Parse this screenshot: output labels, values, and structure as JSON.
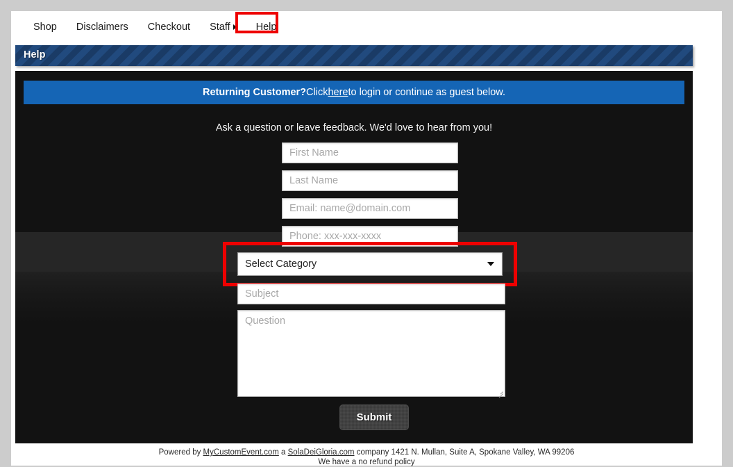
{
  "nav": {
    "items": [
      {
        "label": "Shop",
        "caret": false,
        "highlighted": false
      },
      {
        "label": "Disclaimers",
        "caret": false,
        "highlighted": false
      },
      {
        "label": "Checkout",
        "caret": false,
        "highlighted": false
      },
      {
        "label": "Staff",
        "caret": true,
        "highlighted": false
      },
      {
        "label": "Help",
        "caret": false,
        "highlighted": true
      }
    ]
  },
  "section": {
    "title": "Help"
  },
  "banner": {
    "bold_text": "Returning Customer?",
    "text_before_link": " Click ",
    "link_text": "here",
    "text_after_link": " to login or continue as guest below."
  },
  "intro": {
    "text": "Ask a question or leave feedback. We'd love to hear from you!"
  },
  "form": {
    "first_name": {
      "value": "",
      "placeholder": "First Name"
    },
    "last_name": {
      "value": "",
      "placeholder": "Last Name"
    },
    "email": {
      "value": "",
      "placeholder": "Email: name@domain.com"
    },
    "phone": {
      "value": "",
      "placeholder": "Phone: xxx-xxx-xxxx"
    },
    "category": {
      "selected": "Select Category"
    },
    "subject": {
      "value": "",
      "placeholder": "Subject"
    },
    "question": {
      "value": "",
      "placeholder": "Question"
    },
    "submit_label": "Submit"
  },
  "footer": {
    "prefix": "Powered by ",
    "link1": "MyCustomEvent.com",
    "middle": " a ",
    "link2": "SolaDeiGloria.com",
    "suffix": " company 1421 N. Mullan, Suite A, Spokane Valley, WA 99206",
    "line2": "We have a no refund policy"
  },
  "colors": {
    "page_background": "#cccccc",
    "panel_background": "#121212",
    "banner_blue": "#1565b5",
    "title_bar_blue": "#1d4272",
    "highlight_red": "#ee0000",
    "submit_gray": "#3a3a3a"
  }
}
